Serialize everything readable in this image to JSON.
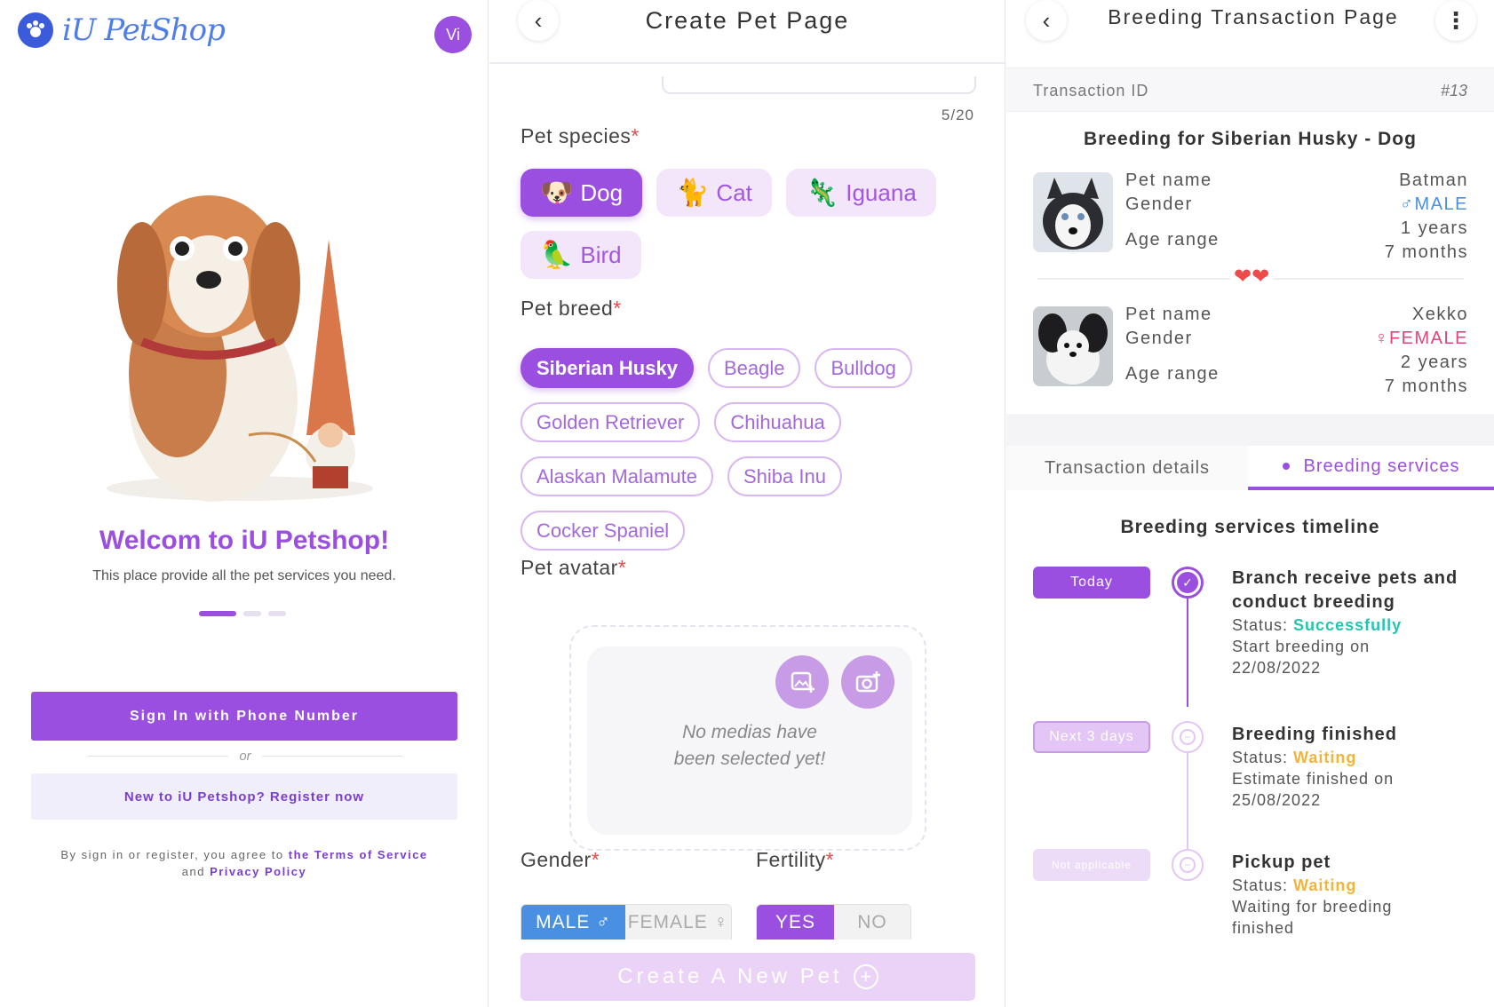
{
  "welcome": {
    "brand_name": "iU PetShop",
    "avatar_initials": "Vi",
    "title": "Welcom to iU Petshop!",
    "subtitle": "This place provide all the pet services you need.",
    "signin_label": "Sign In with Phone Number",
    "or_label": "or",
    "register_label": "New to iU Petshop? Register now",
    "terms_prefix": "By sign in or register, you agree to",
    "terms_link": "the Terms of Service",
    "terms_and": "and",
    "privacy_link": "Privacy Policy",
    "carousel": {
      "pages": 3,
      "active": 1
    }
  },
  "create": {
    "title": "Create Pet Page",
    "name_counter": "5/20",
    "species_label": "Pet species",
    "species": [
      {
        "label": "Dog",
        "icon": "dog-icon",
        "emoji": "🐶",
        "selected": true
      },
      {
        "label": "Cat",
        "icon": "cat-icon",
        "emoji": "🐈",
        "selected": false
      },
      {
        "label": "Iguana",
        "icon": "iguana-icon",
        "emoji": "🦎",
        "selected": false
      },
      {
        "label": "Bird",
        "icon": "bird-icon",
        "emoji": "🦜",
        "selected": false
      }
    ],
    "breed_label": "Pet breed",
    "breeds": [
      {
        "label": "Siberian Husky",
        "selected": true
      },
      {
        "label": "Beagle",
        "selected": false
      },
      {
        "label": "Bulldog",
        "selected": false
      },
      {
        "label": "Golden Retriever",
        "selected": false
      },
      {
        "label": "Chihuahua",
        "selected": false
      },
      {
        "label": "Alaskan Malamute",
        "selected": false
      },
      {
        "label": "Shiba Inu",
        "selected": false
      },
      {
        "label": "Cocker Spaniel",
        "selected": false
      }
    ],
    "avatar_label": "Pet avatar",
    "no_media_line1": "No medias have",
    "no_media_line2": "been selected yet!",
    "gender_label": "Gender",
    "gender_male": "MALE ♂",
    "gender_female": "FEMALE ♀",
    "fertility_label": "Fertility",
    "fertility_yes": "YES",
    "fertility_no": "NO",
    "create_label": "Create A New Pet"
  },
  "breeding": {
    "title": "Breeding Transaction Page",
    "tx_label": "Transaction ID",
    "tx_value": "#13",
    "breeding_for": "Breeding for Siberian Husky - Dog",
    "labels": {
      "name": "Pet name",
      "gender": "Gender",
      "age": "Age range"
    },
    "pet1": {
      "name": "Batman",
      "gender": "♂MALE",
      "age_years": "1 years",
      "age_months": "7 months"
    },
    "pet2": {
      "name": "Xekko",
      "gender": "♀FEMALE",
      "age_years": "2 years",
      "age_months": "7 months"
    },
    "tabs": {
      "details": "Transaction details",
      "services": "Breeding services"
    },
    "timeline_title": "Breeding services timeline",
    "status_prefix": "Status:",
    "steps": [
      {
        "pill": "Today",
        "title_1": "Branch receive pets and",
        "title_2": "conduct breeding",
        "status": "Successfully",
        "line_1": "Start breeding on",
        "line_2": "22/08/2022"
      },
      {
        "pill": "Next 3 days",
        "title_1": "Breeding finished",
        "title_2": "",
        "status": "Waiting",
        "line_1": "Estimate finished on",
        "line_2": "25/08/2022"
      },
      {
        "pill": "Not applicable",
        "title_1": "Pickup pet",
        "title_2": "",
        "status": "Waiting",
        "line_1": "Waiting for breeding",
        "line_2": "finished"
      }
    ]
  },
  "colors": {
    "accent": "#9b4fe0",
    "male": "#4a90e2",
    "female": "#e0447a",
    "success": "#25c3b0",
    "waiting": "#f2b43a"
  }
}
